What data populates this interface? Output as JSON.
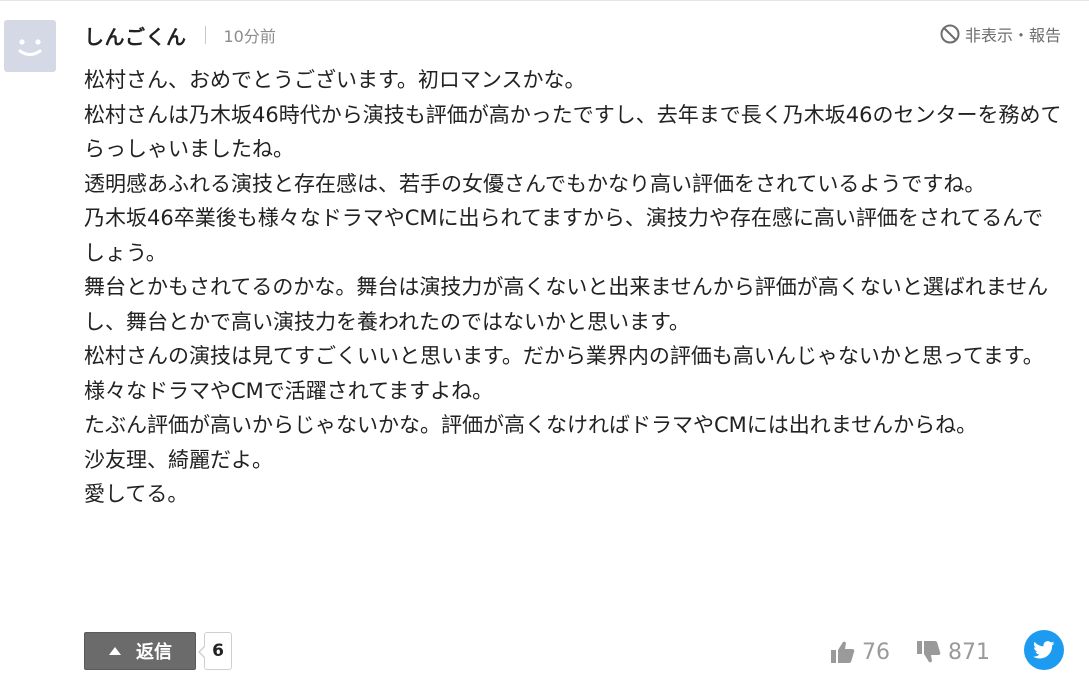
{
  "comment": {
    "author": "しんごくん",
    "separator": "|",
    "time": "10分前",
    "report_label": "非表示・報告",
    "body": [
      "松村さん、おめでとうございます。初ロマンスかな。",
      "松村さんは乃木坂46時代から演技も評価が高かったですし、去年まで長く乃木坂46のセンターを務めてらっしゃいましたね。",
      "透明感あふれる演技と存在感は、若手の女優さんでもかなり高い評価をされているようですね。",
      "乃木坂46卒業後も様々なドラマやCMに出られてますから、演技力や存在感に高い評価をされてるんでしょう。",
      "舞台とかもされてるのかな。舞台は演技力が高くないと出来ませんから評価が高くないと選ばれませんし、舞台とかで高い演技力を養われたのではないかと思います。",
      "松村さんの演技は見てすごくいいと思います。だから業界内の評価も高いんじゃないかと思ってます。",
      "様々なドラマやCMで活躍されてますよね。",
      "たぶん評価が高いからじゃないかな。評価が高くなければドラマやCMには出れませんからね。",
      "沙友理、綺麗だよ。",
      "愛してる。"
    ]
  },
  "footer": {
    "reply_label": "返信",
    "reply_count": "6",
    "likes": "76",
    "dislikes": "871"
  },
  "icons": {
    "avatar": "smiley-avatar-icon",
    "report": "prohibited-icon",
    "reply": "triangle-up-icon",
    "like": "thumbs-up-icon",
    "dislike": "thumbs-down-icon",
    "share": "twitter-icon"
  },
  "colors": {
    "avatar_bg": "#d5d9e6",
    "reply_button_bg": "#6b6b6b",
    "twitter_blue": "#1d9bf0",
    "muted_text": "#9a9a9a"
  }
}
